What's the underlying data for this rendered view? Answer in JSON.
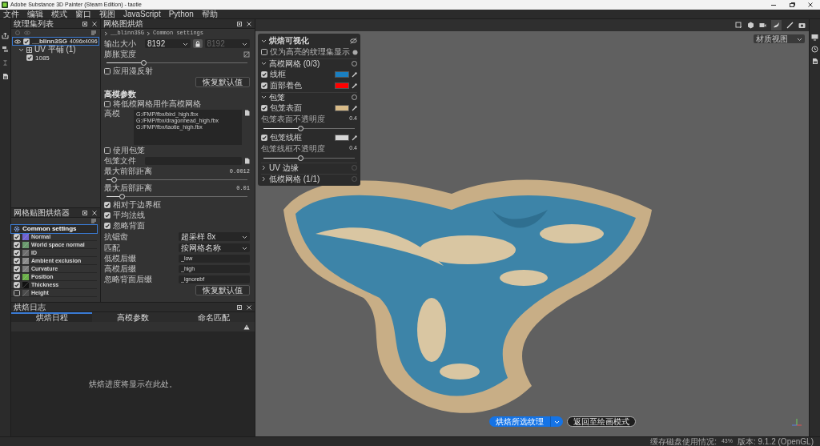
{
  "window": {
    "title": "Adobe Substance 3D Painter (Steam Edition) - taotie"
  },
  "menu": [
    "文件",
    "编辑",
    "模式",
    "窗口",
    "视图",
    "JavaScript",
    "Python",
    "帮助"
  ],
  "texture_sets": {
    "title": "纹理集列表",
    "set": {
      "name": "__blinn3SG",
      "size": "4096x4096",
      "checked": true,
      "selected": true
    },
    "uv_group": {
      "label": "UV 平铺 (1)",
      "expanded": true
    },
    "tiles": [
      {
        "name": "1085",
        "checked": true
      }
    ]
  },
  "bake_settings": {
    "title": "网格图烘焙",
    "breadcrumb": [
      "__blinn3SG",
      "Common settings"
    ],
    "output_size": {
      "label": "输出大小",
      "value": "8192",
      "linked_value": "8192",
      "linked_disabled": true
    },
    "dilation": {
      "label": "膨胀宽度",
      "level": 0.26
    },
    "apply_diffusion": {
      "label": "应用漫反射",
      "checked": false
    },
    "reset_top": "恢复默认值",
    "high_poly_title": "高模参数",
    "use_low_as_high": {
      "label": "将低模网格用作高模网格",
      "checked": false
    },
    "high_poly": {
      "label": "高模",
      "files": [
        "G:/FMP/fbx/bird_high.fbx",
        "G:/FMP/fbx/dragonhead_high.fbx",
        "G:/FMP/fbx/taotie_high.fbx"
      ]
    },
    "use_cage": {
      "label": "使用包笼",
      "checked": false
    },
    "cage_file": {
      "label": "包笼文件"
    },
    "distances": [
      {
        "label": "最大前部距离",
        "value": "0.0012",
        "level": 0.05
      },
      {
        "label": "最大后部距离",
        "value": "0.01",
        "level": 0.11
      }
    ],
    "options": [
      {
        "label": "相对于边界框",
        "checked": true
      },
      {
        "label": "平均法线",
        "checked": true
      },
      {
        "label": "忽略背面",
        "checked": true
      }
    ],
    "selects": [
      {
        "label": "抗锯齿",
        "value": "超采样 8x"
      },
      {
        "label": "匹配",
        "value": "按网格名称"
      }
    ],
    "suffixes": [
      {
        "label": "低模后缀",
        "value": "_low"
      },
      {
        "label": "高模后缀",
        "value": "_high"
      },
      {
        "label": "忽略背面后缀",
        "value": "_ignorebf"
      }
    ],
    "reset_bottom": "恢复默认值"
  },
  "mesh_maps": {
    "title": "网格贴图烘焙器",
    "items": [
      {
        "label": "Common settings",
        "kind": "settings",
        "selected": true
      },
      {
        "label": "Normal",
        "kind": "map",
        "checked": true,
        "selected": false,
        "color": "#6f62d0"
      },
      {
        "label": "World space normal",
        "kind": "map",
        "checked": true,
        "selected": false,
        "color": "#6a9a6e"
      },
      {
        "label": "ID",
        "kind": "map",
        "checked": true,
        "selected": false,
        "color": "#6e6e6e"
      },
      {
        "label": "Ambient exclusion",
        "kind": "map",
        "checked": true,
        "selected": false,
        "color": "#8a8a8a"
      },
      {
        "label": "Curvature",
        "kind": "map",
        "checked": true,
        "selected": false,
        "color": "#7c7c7c"
      },
      {
        "label": "Position",
        "kind": "map",
        "checked": true,
        "selected": false,
        "color": "#6cb04a"
      },
      {
        "label": "Thickness",
        "kind": "map",
        "checked": true,
        "selected": false,
        "color": "#111111"
      },
      {
        "label": "Height",
        "kind": "map",
        "checked": false,
        "selected": false,
        "color": "#4c4c4c"
      }
    ]
  },
  "bake_log": {
    "title": "烘焙日志",
    "tabs": [
      {
        "label": "烘焙日程",
        "selected": true
      },
      {
        "label": "高模参数",
        "selected": false
      },
      {
        "label": "命名匹配",
        "selected": false
      }
    ],
    "message": "烘焙进度将显示在此处。"
  },
  "viewport": {
    "view_select": "材质视图",
    "bake_button": "烘焙所选纹理",
    "return_button": "返回至绘画模式"
  },
  "overlay": {
    "title": "烘焙可视化",
    "highlight_only": {
      "label": "仅为高亮的纹理集显示",
      "checked": false
    },
    "sections": [
      {
        "title": "高模网格 (0/3)",
        "expanded": true,
        "items": [
          {
            "kind": "color",
            "label": "线框",
            "checked": true,
            "color": "#1a7fc1"
          },
          {
            "kind": "color",
            "label": "面部着色",
            "checked": true,
            "color": "#ff0000"
          }
        ]
      },
      {
        "title": "包笼",
        "expanded": true,
        "items": [
          {
            "kind": "color",
            "label": "包笼表面",
            "checked": true,
            "color": "#d8bb88"
          },
          {
            "kind": "slider",
            "label": "包笼表面不透明度",
            "value": "0.4",
            "level": 0.4
          },
          {
            "kind": "color",
            "label": "包笼线框",
            "checked": true,
            "color": "#d6d6d6"
          },
          {
            "kind": "slider",
            "label": "包笼线框不透明度",
            "value": "0.4",
            "level": 0.4
          }
        ]
      },
      {
        "title": "UV 边缘",
        "expanded": false
      },
      {
        "title": "低模网格 (1/1)",
        "expanded": false
      }
    ]
  },
  "status_bar": {
    "label": "缓存磁盘使用情况:",
    "usage": "43%",
    "version": "版本: 9.1.2 (OpenGL)"
  }
}
